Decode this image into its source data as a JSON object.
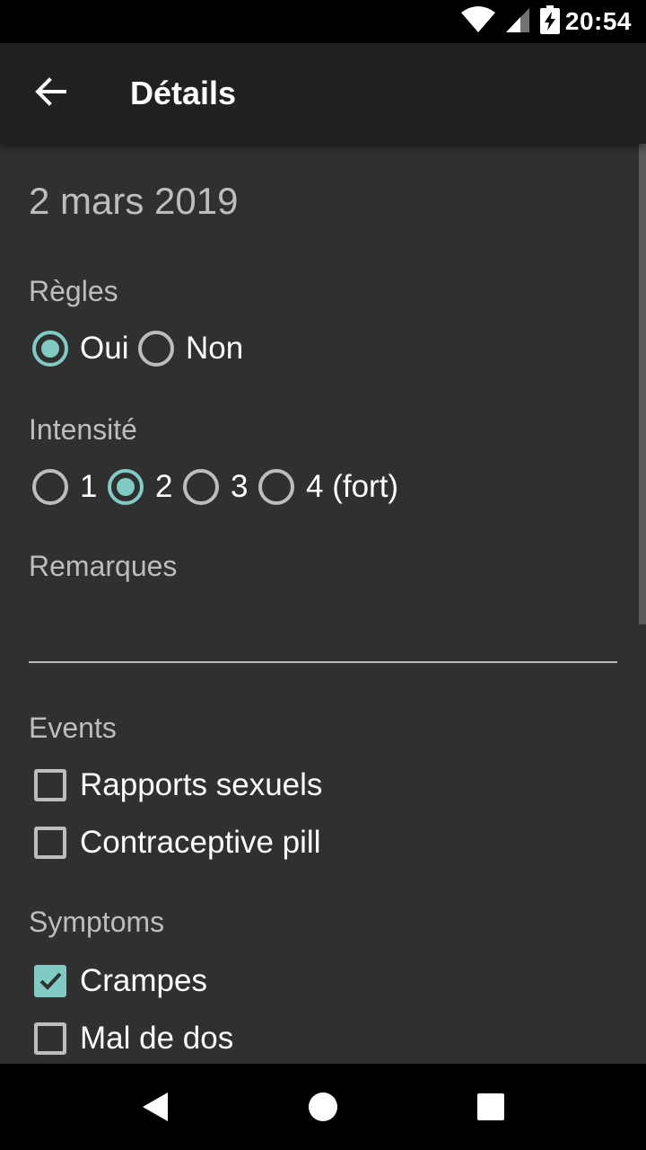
{
  "status_bar": {
    "time": "20:54"
  },
  "app_bar": {
    "title": "Détails"
  },
  "content": {
    "date": "2 mars 2019",
    "regles": {
      "label": "Règles",
      "options": [
        {
          "label": "Oui",
          "checked": true
        },
        {
          "label": "Non",
          "checked": false
        }
      ]
    },
    "intensite": {
      "label": "Intensité",
      "options": [
        {
          "label": "1",
          "checked": false
        },
        {
          "label": "2",
          "checked": true
        },
        {
          "label": "3",
          "checked": false
        },
        {
          "label": "4 (fort)",
          "checked": false
        }
      ]
    },
    "remarques": {
      "label": "Remarques",
      "value": ""
    },
    "events": {
      "label": "Events",
      "items": [
        {
          "label": "Rapports sexuels",
          "checked": false
        },
        {
          "label": "Contraceptive pill",
          "checked": false
        }
      ]
    },
    "symptoms": {
      "label": "Symptoms",
      "items": [
        {
          "label": "Crampes",
          "checked": true
        },
        {
          "label": "Mal de dos",
          "checked": false
        }
      ]
    }
  },
  "colors": {
    "accent": "#80cbc4",
    "background": "#303030",
    "app_bar": "#212121",
    "secondary_text": "#bdbdbd"
  }
}
